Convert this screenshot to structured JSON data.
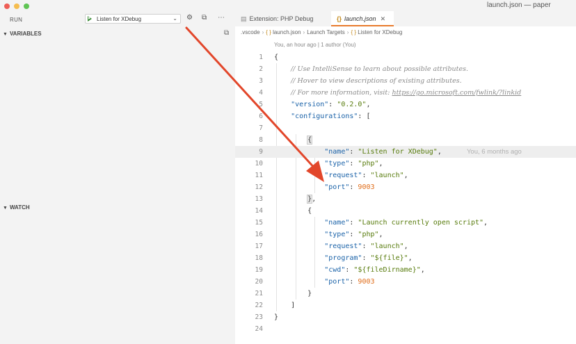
{
  "window": {
    "title": "launch.json — paper"
  },
  "sidebar": {
    "run_label": "RUN",
    "config_select": {
      "value": "Listen for XDebug"
    },
    "sections": {
      "variables": "VARIABLES",
      "watch": "WATCH"
    }
  },
  "tabs": [
    {
      "label": "Extension: PHP Debug",
      "icon": "extension-icon"
    },
    {
      "label": "launch.json",
      "icon": "json-braces-icon"
    }
  ],
  "breadcrumb": [
    ".vscode",
    "launch.json",
    "Launch Targets",
    "Listen for XDebug"
  ],
  "breadcrumb_icon": "{ }",
  "blame_header": "You, an hour ago | 1 author (You)",
  "inline_blame": "You, 6 months ago",
  "code_lines": {
    "l2": "// Use IntelliSense to learn about possible attributes.",
    "l3": "// Hover to view descriptions of existing attributes.",
    "l4_text": "// For more information, visit: ",
    "l4_link": "https://go.microsoft.com/fwlink/?linkid",
    "version_key": "\"version\"",
    "version_val": "\"0.2.0\"",
    "configurations_key": "\"configurations\"",
    "c1": {
      "name": "\"Listen for XDebug\"",
      "type": "\"php\"",
      "request": "\"launch\"",
      "port": "9003"
    },
    "c2": {
      "name": "\"Launch currently open script\"",
      "type": "\"php\"",
      "request": "\"launch\"",
      "program": "\"${file}\"",
      "cwd": "\"${fileDirname}\"",
      "port": "9003"
    },
    "keys": {
      "name": "\"name\"",
      "type": "\"type\"",
      "request": "\"request\"",
      "port": "\"port\"",
      "program": "\"program\"",
      "cwd": "\"cwd\""
    }
  },
  "line_numbers": [
    "1",
    "2",
    "3",
    "4",
    "5",
    "6",
    "7",
    "8",
    "9",
    "10",
    "11",
    "12",
    "13",
    "14",
    "15",
    "16",
    "17",
    "18",
    "19",
    "20",
    "21",
    "22",
    "23",
    "24"
  ],
  "colors": {
    "accent_tab": "#e87a2b",
    "arrow": "#e2462a",
    "keyword": "#1a62a8",
    "string": "#567a0a",
    "number": "#e06d1a"
  }
}
